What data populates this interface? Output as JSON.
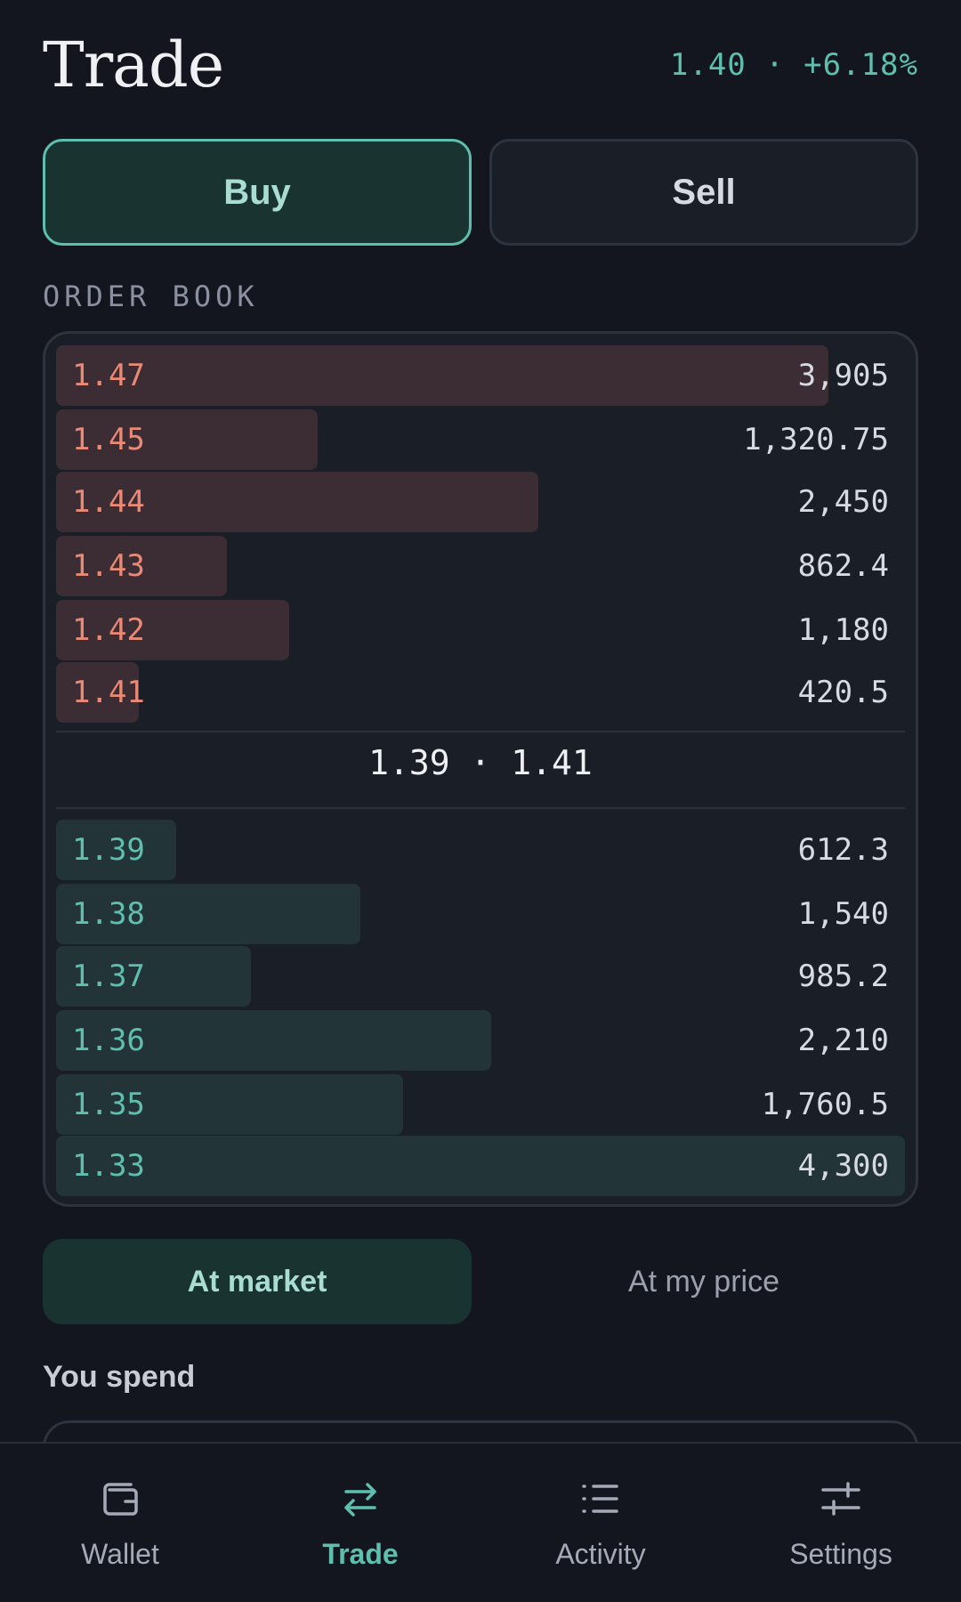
{
  "header": {
    "title": "Trade",
    "ticker": "1.40 · +6.18%"
  },
  "side_toggle": {
    "buy_label": "Buy",
    "sell_label": "Sell",
    "selected": "Buy"
  },
  "order_book": {
    "label": "ORDER BOOK",
    "asks": [
      {
        "price": "1.47",
        "size": "3,905"
      },
      {
        "price": "1.45",
        "size": "1,320.75"
      },
      {
        "price": "1.44",
        "size": "2,450"
      },
      {
        "price": "1.43",
        "size": "862.4"
      },
      {
        "price": "1.42",
        "size": "1,180"
      },
      {
        "price": "1.41",
        "size": "420.5"
      }
    ],
    "spread": "1.39 · 1.41",
    "bids": [
      {
        "price": "1.39",
        "size": "612.3"
      },
      {
        "price": "1.38",
        "size": "1,540"
      },
      {
        "price": "1.37",
        "size": "985.2"
      },
      {
        "price": "1.36",
        "size": "2,210"
      },
      {
        "price": "1.35",
        "size": "1,760.5"
      },
      {
        "price": "1.33",
        "size": "4,300"
      }
    ]
  },
  "order_mode": {
    "market_label": "At market",
    "limit_label": "At my price",
    "selected": "At market"
  },
  "spend": {
    "label": "You spend"
  },
  "nav": {
    "items": [
      {
        "label": "Wallet",
        "icon": "wallet-icon"
      },
      {
        "label": "Trade",
        "icon": "swap-icon"
      },
      {
        "label": "Activity",
        "icon": "list-icon"
      },
      {
        "label": "Settings",
        "icon": "sliders-icon"
      }
    ],
    "active": "Trade"
  },
  "colors": {
    "accent": "#5fbfae",
    "ask": "#e98976",
    "background": "#13161e"
  }
}
